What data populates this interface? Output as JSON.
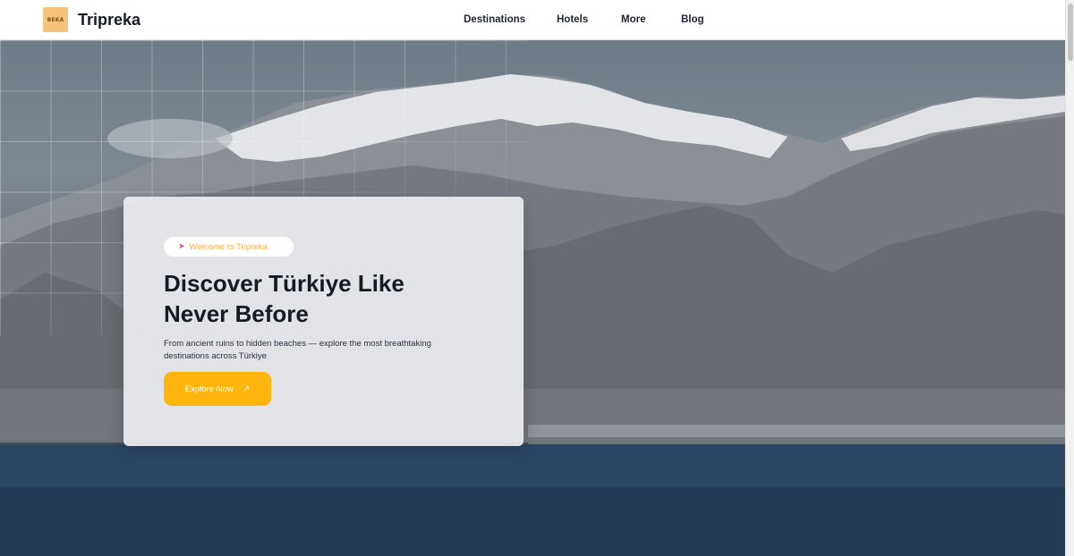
{
  "header": {
    "logo_text": "BEKA",
    "brand": "Tripreka",
    "nav": [
      {
        "label": "Destinations"
      },
      {
        "label": "Hotels"
      },
      {
        "label": "More"
      },
      {
        "label": "Blog"
      }
    ]
  },
  "hero": {
    "badge": "Welcome to Tripreka",
    "badge_icon": "rocket-icon",
    "headline_line1": "Discover Türkiye Like",
    "headline_line2": "Never Before",
    "subtext_line1": "From ancient ruins to hidden beaches — explore the most breathtaking",
    "subtext_line2": "destinations across Türkiye",
    "cta_label": "Explore Now",
    "cta_icon": "arrow-up-right-icon"
  },
  "colors": {
    "accent": "#ffb40e",
    "badge_text": "#f5b24a",
    "heading": "#151a24",
    "logo_bg": "#f4c27a"
  }
}
